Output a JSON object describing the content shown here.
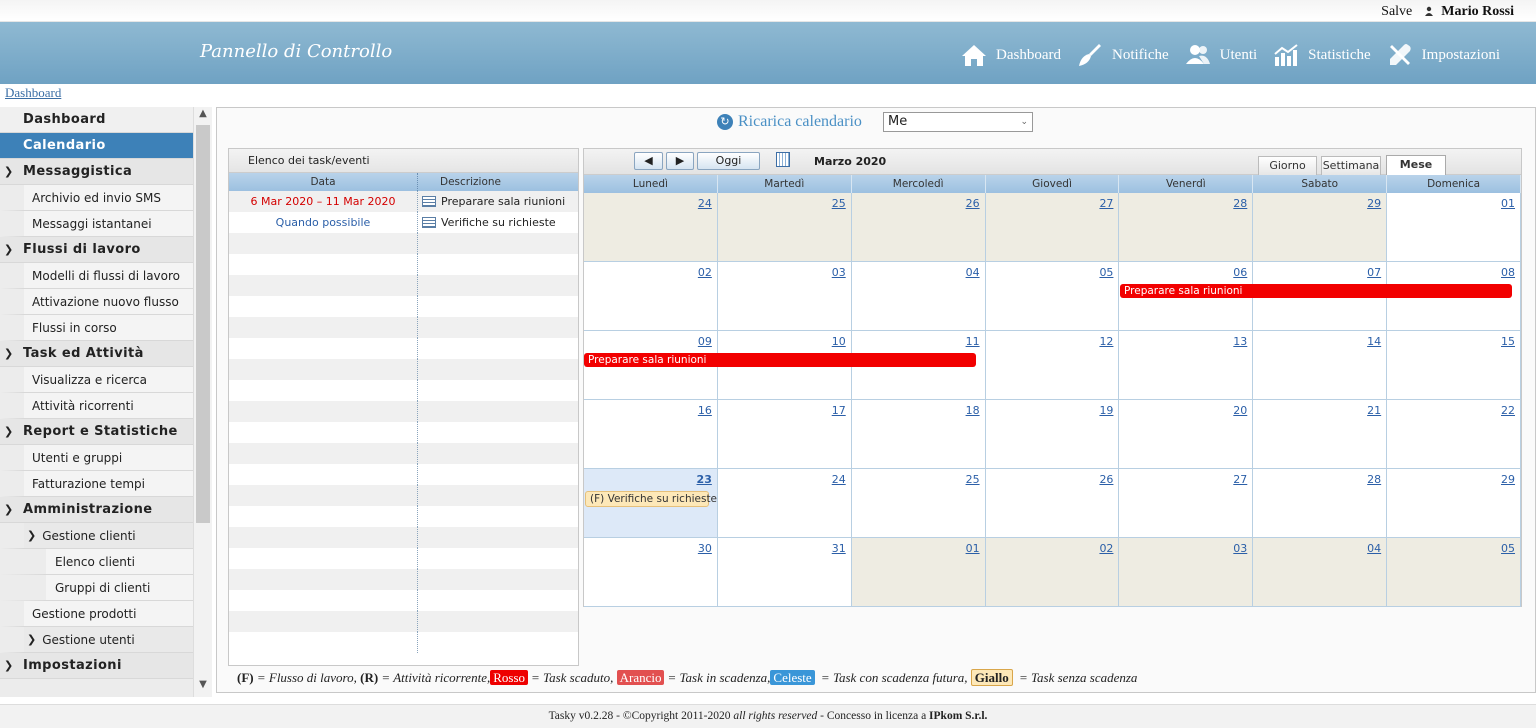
{
  "topbar": {
    "greeting": "Salve",
    "user_name": "Mario Rossi"
  },
  "header": {
    "brand": "Pannello di Controllo",
    "nav": [
      {
        "label": "Dashboard",
        "icon": "home-icon"
      },
      {
        "label": "Notifiche",
        "icon": "broom-icon"
      },
      {
        "label": "Utenti",
        "icon": "users-icon"
      },
      {
        "label": "Statistiche",
        "icon": "stats-icon"
      },
      {
        "label": "Impostazioni",
        "icon": "tools-icon"
      }
    ]
  },
  "breadcrumb": "Dashboard",
  "sidebar": {
    "dashboard": "Dashboard",
    "calendario": "Calendario",
    "messaggistica": "Messaggistica",
    "archivio_sms": "Archivio ed invio SMS",
    "messaggi_istantanei": "Messaggi istantanei",
    "flussi": "Flussi di lavoro",
    "modelli_flussi": "Modelli di flussi di lavoro",
    "attivazione_flusso": "Attivazione nuovo flusso",
    "flussi_corso": "Flussi in corso",
    "task": "Task ed Attività",
    "visualizza": "Visualizza e ricerca",
    "ricorrenti": "Attività ricorrenti",
    "report": "Report e Statistiche",
    "utenti_gruppi": "Utenti e gruppi",
    "fatturazione": "Fatturazione tempi",
    "amministrazione": "Amministrazione",
    "gestione_clienti": "Gestione clienti",
    "elenco_clienti": "Elenco clienti",
    "gruppi_clienti": "Gruppi di clienti",
    "gestione_prodotti": "Gestione prodotti",
    "gestione_utenti": "Gestione utenti",
    "impostazioni": "Impostazioni"
  },
  "reload": {
    "label": "Ricarica calendario",
    "select_value": "Me"
  },
  "tasks": {
    "title": "Elenco dei task/eventi",
    "col_date": "Data",
    "col_desc": "Descrizione",
    "rows": [
      {
        "date": "6 Mar 2020 – 11 Mar 2020",
        "desc": "Preparare sala riunioni",
        "date_color": "#d40000"
      },
      {
        "date": "Quando possibile",
        "desc": "Verifiche su richieste",
        "date_color": "#2b5fa8"
      }
    ]
  },
  "calendar": {
    "btn_today": "Oggi",
    "month": "Marzo 2020",
    "views": {
      "day": "Giorno",
      "week": "Settimana",
      "month": "Mese"
    },
    "days": [
      "Lunedì",
      "Martedì",
      "Mercoledì",
      "Giovedì",
      "Venerdì",
      "Sabato",
      "Domenica"
    ],
    "weeks": [
      [
        "24",
        "25",
        "26",
        "27",
        "28",
        "29",
        "01"
      ],
      [
        "02",
        "03",
        "04",
        "05",
        "06",
        "07",
        "08"
      ],
      [
        "09",
        "10",
        "11",
        "12",
        "13",
        "14",
        "15"
      ],
      [
        "16",
        "17",
        "18",
        "19",
        "20",
        "21",
        "22"
      ],
      [
        "23",
        "24",
        "25",
        "26",
        "27",
        "28",
        "29"
      ],
      [
        "30",
        "31",
        "01",
        "02",
        "03",
        "04",
        "05"
      ]
    ],
    "events": {
      "e1": "Preparare sala riunioni",
      "e2": "Preparare sala riunioni",
      "e3": "(F) Verifiche su richieste"
    }
  },
  "legend": {
    "f": "(F)",
    "f_text": "= Flusso di lavoro,",
    "r": "(R)",
    "r_text": "= Attività ricorrente,",
    "rosso": "Rosso",
    "rosso_text": "= Task scaduto,",
    "arancio": "Arancio",
    "arancio_text": "= Task in scadenza,",
    "celeste": "Celeste",
    "celeste_text": "= Task con scadenza futura,",
    "giallo": "Giallo",
    "giallo_text": "= Task senza scadenza"
  },
  "footer": {
    "pre": "Tasky v0.2.28 - ©Copyright 2011-2020",
    "rights": "all rights reserved",
    "mid": "- Concesso in licenza a",
    "company": "IPkom S.r.l."
  }
}
